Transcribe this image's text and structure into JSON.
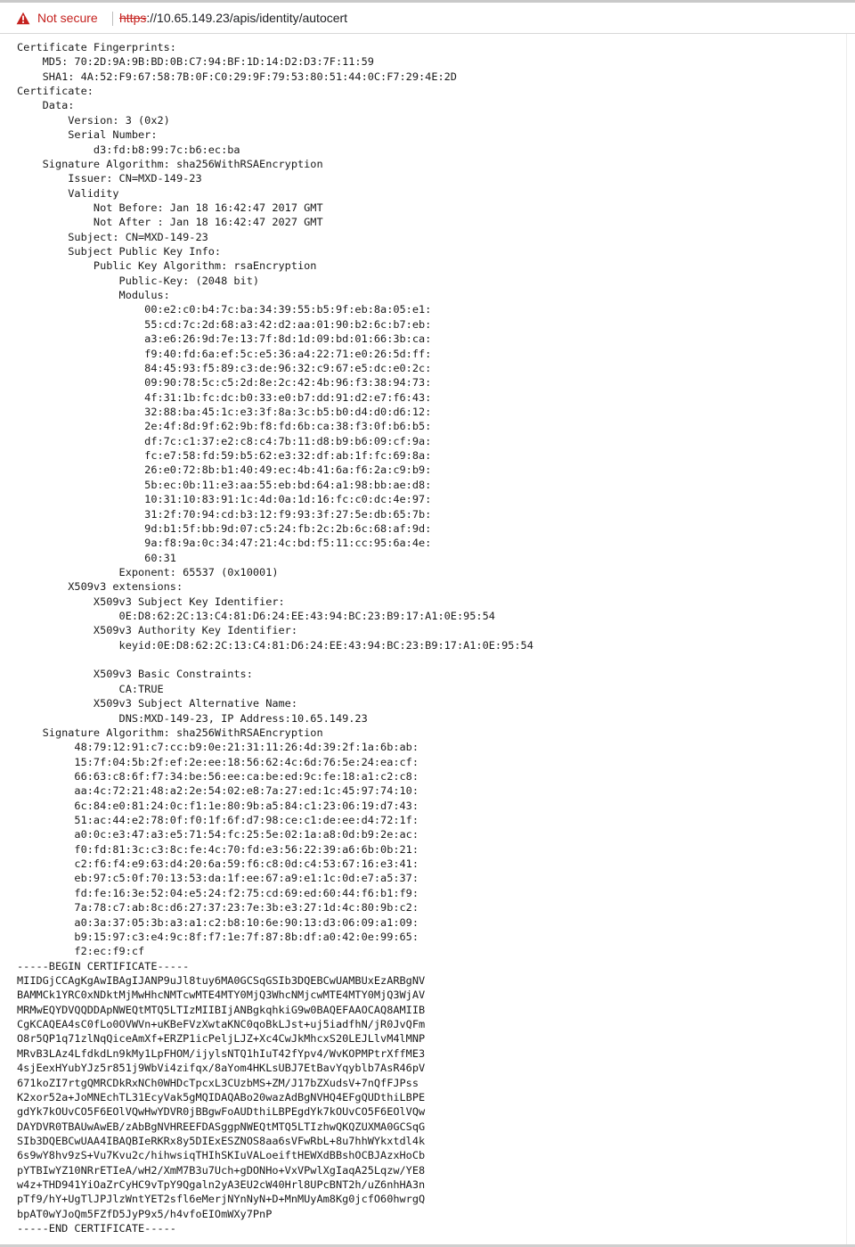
{
  "browser": {
    "security_label": "Not secure",
    "url_scheme": "https",
    "url_rest": "://10.65.149.23/apis/identity/autocert",
    "warning_color": "#c5221f",
    "warning_icon": "warning-triangle"
  },
  "certificate": {
    "lines": [
      "Certificate Fingerprints:",
      "    MD5: 70:2D:9A:9B:BD:0B:C7:94:BF:1D:14:D2:D3:7F:11:59",
      "    SHA1: 4A:52:F9:67:58:7B:0F:C0:29:9F:79:53:80:51:44:0C:F7:29:4E:2D",
      "Certificate:",
      "    Data:",
      "        Version: 3 (0x2)",
      "        Serial Number:",
      "            d3:fd:b8:99:7c:b6:ec:ba",
      "    Signature Algorithm: sha256WithRSAEncryption",
      "        Issuer: CN=MXD-149-23",
      "        Validity",
      "            Not Before: Jan 18 16:42:47 2017 GMT",
      "            Not After : Jan 18 16:42:47 2027 GMT",
      "        Subject: CN=MXD-149-23",
      "        Subject Public Key Info:",
      "            Public Key Algorithm: rsaEncryption",
      "                Public-Key: (2048 bit)",
      "                Modulus:",
      "                    00:e2:c0:b4:7c:ba:34:39:55:b5:9f:eb:8a:05:e1:",
      "                    55:cd:7c:2d:68:a3:42:d2:aa:01:90:b2:6c:b7:eb:",
      "                    a3:e6:26:9d:7e:13:7f:8d:1d:09:bd:01:66:3b:ca:",
      "                    f9:40:fd:6a:ef:5c:e5:36:a4:22:71:e0:26:5d:ff:",
      "                    84:45:93:f5:89:c3:de:96:32:c9:67:e5:dc:e0:2c:",
      "                    09:90:78:5c:c5:2d:8e:2c:42:4b:96:f3:38:94:73:",
      "                    4f:31:1b:fc:dc:b0:33:e0:b7:dd:91:d2:e7:f6:43:",
      "                    32:88:ba:45:1c:e3:3f:8a:3c:b5:b0:d4:d0:d6:12:",
      "                    2e:4f:8d:9f:62:9b:f8:fd:6b:ca:38:f3:0f:b6:b5:",
      "                    df:7c:c1:37:e2:c8:c4:7b:11:d8:b9:b6:09:cf:9a:",
      "                    fc:e7:58:fd:59:b5:62:e3:32:df:ab:1f:fc:69:8a:",
      "                    26:e0:72:8b:b1:40:49:ec:4b:41:6a:f6:2a:c9:b9:",
      "                    5b:ec:0b:11:e3:aa:55:eb:bd:64:a1:98:bb:ae:d8:",
      "                    10:31:10:83:91:1c:4d:0a:1d:16:fc:c0:dc:4e:97:",
      "                    31:2f:70:94:cd:b3:12:f9:93:3f:27:5e:db:65:7b:",
      "                    9d:b1:5f:bb:9d:07:c5:24:fb:2c:2b:6c:68:af:9d:",
      "                    9a:f8:9a:0c:34:47:21:4c:bd:f5:11:cc:95:6a:4e:",
      "                    60:31",
      "                Exponent: 65537 (0x10001)",
      "        X509v3 extensions:",
      "            X509v3 Subject Key Identifier:",
      "                0E:D8:62:2C:13:C4:81:D6:24:EE:43:94:BC:23:B9:17:A1:0E:95:54",
      "            X509v3 Authority Key Identifier:",
      "                keyid:0E:D8:62:2C:13:C4:81:D6:24:EE:43:94:BC:23:B9:17:A1:0E:95:54",
      "",
      "            X509v3 Basic Constraints:",
      "                CA:TRUE",
      "            X509v3 Subject Alternative Name:",
      "                DNS:MXD-149-23, IP Address:10.65.149.23",
      "    Signature Algorithm: sha256WithRSAEncryption",
      "         48:79:12:91:c7:cc:b9:0e:21:31:11:26:4d:39:2f:1a:6b:ab:",
      "         15:7f:04:5b:2f:ef:2e:ee:18:56:62:4c:6d:76:5e:24:ea:cf:",
      "         66:63:c8:6f:f7:34:be:56:ee:ca:be:ed:9c:fe:18:a1:c2:c8:",
      "         aa:4c:72:21:48:a2:2e:54:02:e8:7a:27:ed:1c:45:97:74:10:",
      "         6c:84:e0:81:24:0c:f1:1e:80:9b:a5:84:c1:23:06:19:d7:43:",
      "         51:ac:44:e2:78:0f:f0:1f:6f:d7:98:ce:c1:de:ee:d4:72:1f:",
      "         a0:0c:e3:47:a3:e5:71:54:fc:25:5e:02:1a:a8:0d:b9:2e:ac:",
      "         f0:fd:81:3c:c3:8c:fe:4c:70:fd:e3:56:22:39:a6:6b:0b:21:",
      "         c2:f6:f4:e9:63:d4:20:6a:59:f6:c8:0d:c4:53:67:16:e3:41:",
      "         eb:97:c5:0f:70:13:53:da:1f:ee:67:a9:e1:1c:0d:e7:a5:37:",
      "         fd:fe:16:3e:52:04:e5:24:f2:75:cd:69:ed:60:44:f6:b1:f9:",
      "         7a:78:c7:ab:8c:d6:27:37:23:7e:3b:e3:27:1d:4c:80:9b:c2:",
      "         a0:3a:37:05:3b:a3:a1:c2:b8:10:6e:90:13:d3:06:09:a1:09:",
      "         b9:15:97:c3:e4:9c:8f:f7:1e:7f:87:8b:df:a0:42:0e:99:65:",
      "         f2:ec:f9:cf",
      "-----BEGIN CERTIFICATE-----",
      "MIIDGjCCAgKgAwIBAgIJANP9uJl8tuy6MA0GCSqGSIb3DQEBCwUAMBUxEzARBgNV",
      "BAMMCk1YRC0xNDktMjMwHhcNMTcwMTE4MTY0MjQ3WhcNMjcwMTE4MTY0MjQ3WjAV",
      "MRMwEQYDVQQDDApNWEQtMTQ5LTIzMIIBIjANBgkqhkiG9w0BAQEFAAOCAQ8AMIIB",
      "CgKCAQEA4sC0fLo0OVWVn+uKBeFVzXwtaKNC0qoBkLJst+uj5iadfhN/jR0JvQFm",
      "O8r5QP1q71zlNqQiceAmXf+ERZP1icPeljLJZ+Xc4CwJkMhcxS20LEJLlvM4lMNP",
      "MRvB3LAz4LfdkdLn9kMy1LpFHOM/ijylsNTQ1hIuT42fYpv4/WvKOPMPtrXffME3",
      "4sjEexHYubYJz5r851j9WbVi4zifqx/8aYom4HKLsUBJ7EtBavYqyblb7AsR46pV",
      "671koZI7rtgQMRCDkRxNCh0WHDcTpcxL3CUzbMS+ZM/J17bZXudsV+7nQfFJPss",
      "K2xor52a+JoMNEchTL31EcyVak5gMQIDAQABo20wazAdBgNVHQ4EFgQUDthiLBPE",
      "gdYk7kOUvCO5F6EOlVQwHwYDVR0jBBgwFoAUDthiLBPEgdYk7kOUvCO5F6EOlVQw",
      "DAYDVR0TBAUwAwEB/zAbBgNVHREEFDASggpNWEQtMTQ5LTIzhwQKQZUXMA0GCSqG",
      "SIb3DQEBCwUAA4IBAQBIeRKRx8y5DIExESZNOS8aa6sVFwRbL+8u7hhWYkxtdl4k",
      "6s9wY8hv9zS+Vu7Kvu2c/hihwsiqTHIhSKIuVALoeiftHEWXdBBshOCBJAzxHoCb",
      "pYTBIwYZ10NRrETIeA/wH2/XmM7B3u7Uch+gDONHo+VxVPwlXgIaqA25Lqzw/YE8",
      "w4z+THD941YiOaZrCyHC9vTpY9Qgaln2yA3EU2cW40Hrl8UPcBNT2h/uZ6nhHA3n",
      "pTf9/hY+UgTlJPJlzWntYET2sfl6eMerjNYnNyN+D+MnMUyAm8Kg0jcfO60hwrgQ",
      "bpAT0wYJoQm5FZfD5JyP9x5/h4vfoEIOmWXy7PnP",
      "-----END CERTIFICATE-----"
    ]
  }
}
